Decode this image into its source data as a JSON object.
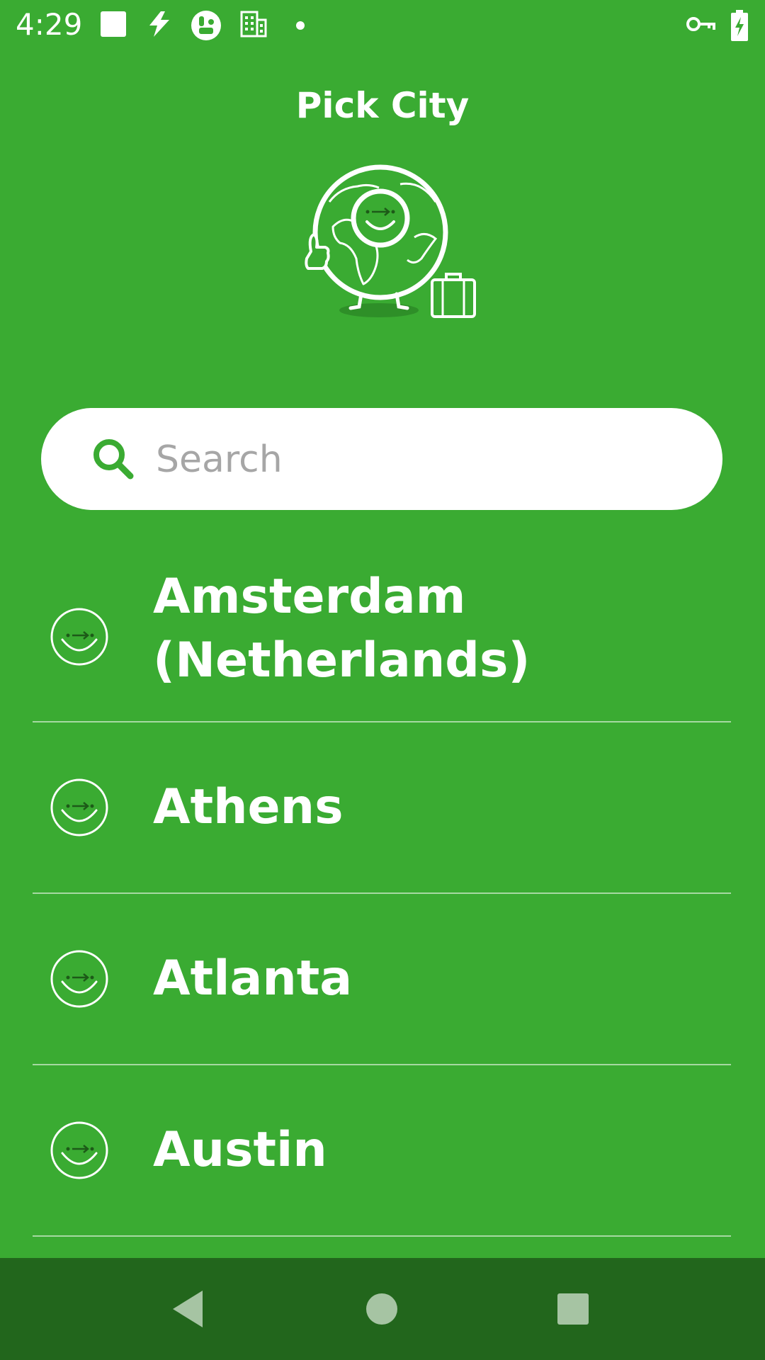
{
  "status_bar": {
    "time": "4:29",
    "icons": [
      "stop-square-icon",
      "bolt-icon",
      "app-logo-icon",
      "building-icon",
      "dot-icon",
      "vpn-key-icon",
      "battery-charging-icon"
    ]
  },
  "header": {
    "title": "Pick City",
    "mascot": "globe-mascot-illustration"
  },
  "search": {
    "placeholder": "Search",
    "value": "",
    "icon": "search-icon"
  },
  "cities": [
    {
      "name": "Amsterdam (Netherlands)",
      "icon": "smiley-arrow-icon"
    },
    {
      "name": "Athens",
      "icon": "smiley-arrow-icon"
    },
    {
      "name": "Atlanta",
      "icon": "smiley-arrow-icon"
    },
    {
      "name": "Austin",
      "icon": "smiley-arrow-icon"
    }
  ],
  "nav_bar": {
    "buttons": [
      "back-icon",
      "home-icon",
      "recents-icon"
    ]
  },
  "colors": {
    "background": "#3aab32",
    "nav_bar": "#22661c",
    "search_icon": "#3aab32",
    "text": "#ffffff"
  }
}
